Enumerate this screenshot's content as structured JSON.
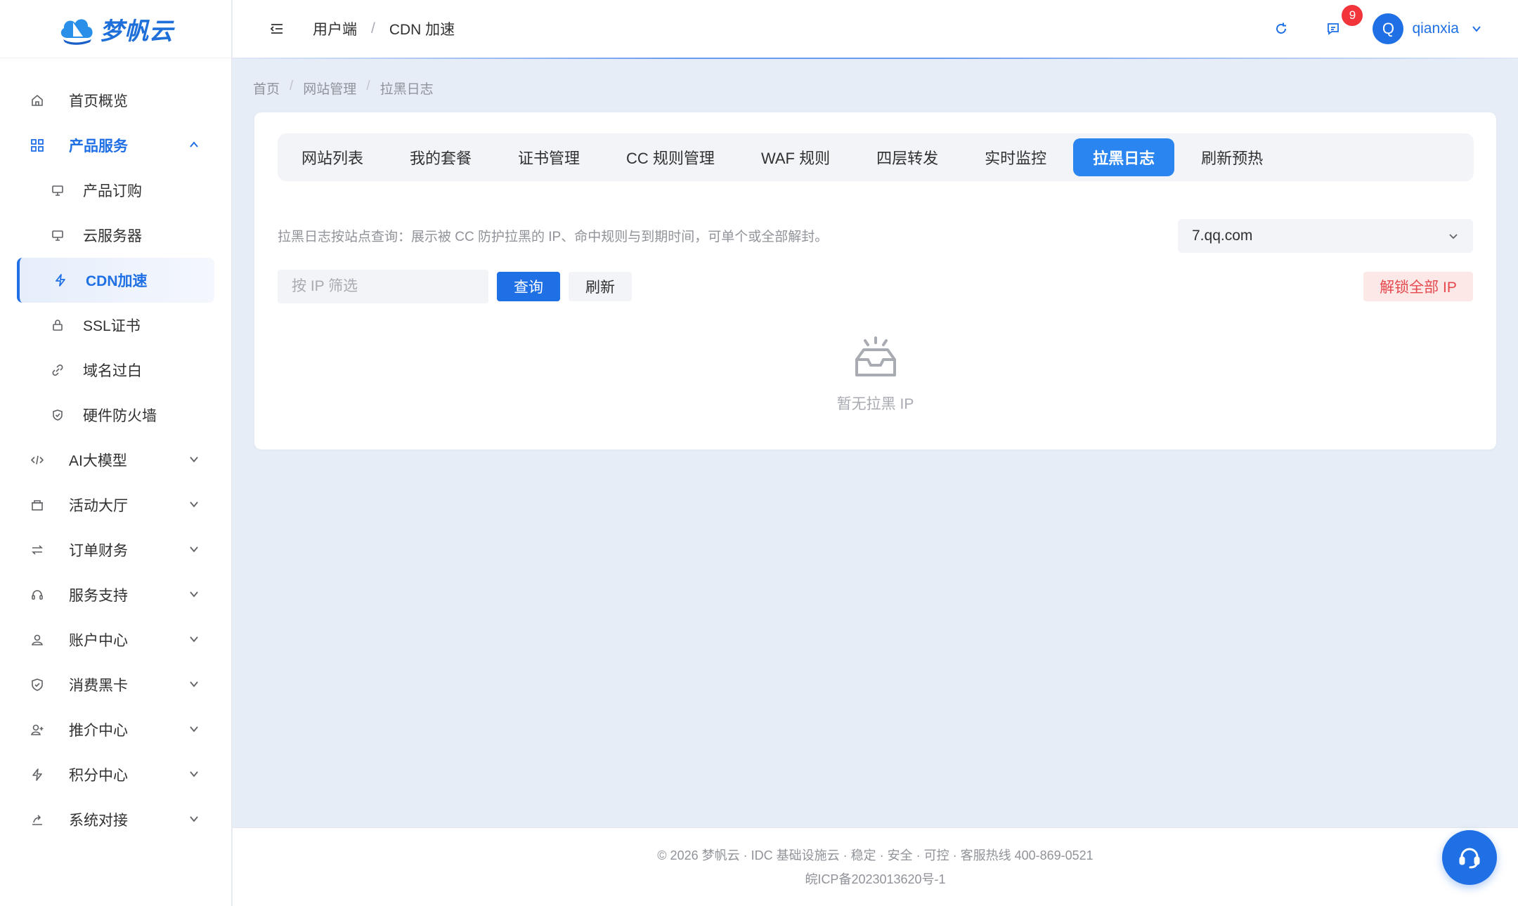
{
  "brand": {
    "name": "梦帆云"
  },
  "sidebar": {
    "items": [
      {
        "label": "首页概览",
        "icon": "home-icon"
      },
      {
        "label": "产品服务",
        "icon": "grid-icon",
        "open": true,
        "children": [
          {
            "label": "产品订购",
            "icon": "monitor-icon"
          },
          {
            "label": "云服务器",
            "icon": "monitor-icon"
          },
          {
            "label": "CDN加速",
            "icon": "lightning-icon",
            "active": true
          },
          {
            "label": "SSL证书",
            "icon": "lock-icon"
          },
          {
            "label": "域名过白",
            "icon": "link-icon"
          },
          {
            "label": "硬件防火墙",
            "icon": "shield-icon"
          }
        ]
      },
      {
        "label": "AI大模型",
        "icon": "code-icon"
      },
      {
        "label": "活动大厅",
        "icon": "gift-icon"
      },
      {
        "label": "订单财务",
        "icon": "swap-icon"
      },
      {
        "label": "服务支持",
        "icon": "headset-icon"
      },
      {
        "label": "账户中心",
        "icon": "user-icon"
      },
      {
        "label": "消费黑卡",
        "icon": "shield-icon"
      },
      {
        "label": "推介中心",
        "icon": "user-plus-icon"
      },
      {
        "label": "积分中心",
        "icon": "lightning-icon"
      },
      {
        "label": "系统对接",
        "icon": "share-icon"
      }
    ]
  },
  "header": {
    "breadcrumb": [
      "用户端",
      "CDN 加速"
    ],
    "notification_count": "9",
    "avatar_letter": "Q",
    "username": "qianxia"
  },
  "page": {
    "breadcrumb": [
      "首页",
      "网站管理",
      "拉黑日志"
    ],
    "tabs": [
      "网站列表",
      "我的套餐",
      "证书管理",
      "CC 规则管理",
      "WAF 规则",
      "四层转发",
      "实时监控",
      "拉黑日志",
      "刷新预热"
    ],
    "active_tab": "拉黑日志",
    "description": "拉黑日志按站点查询：展示被 CC 防护拉黑的 IP、命中规则与到期时间，可单个或全部解封。",
    "site_select": "7.qq.com",
    "filter_placeholder": "按 IP 筛选",
    "query_label": "查询",
    "refresh_label": "刷新",
    "unlock_all_label": "解锁全部 IP",
    "empty_text": "暂无拉黑 IP"
  },
  "footer": {
    "line1": "© 2026 梦帆云 · IDC 基础设施云 · 稳定 · 安全 · 可控 · 客服热线 400-869-0521",
    "line2": "皖ICP备2023013620号-1"
  },
  "colors": {
    "primary": "#1f6fe5",
    "tab_active": "#2b85f0",
    "danger": "#e5484d",
    "badge": "#f1353b"
  }
}
